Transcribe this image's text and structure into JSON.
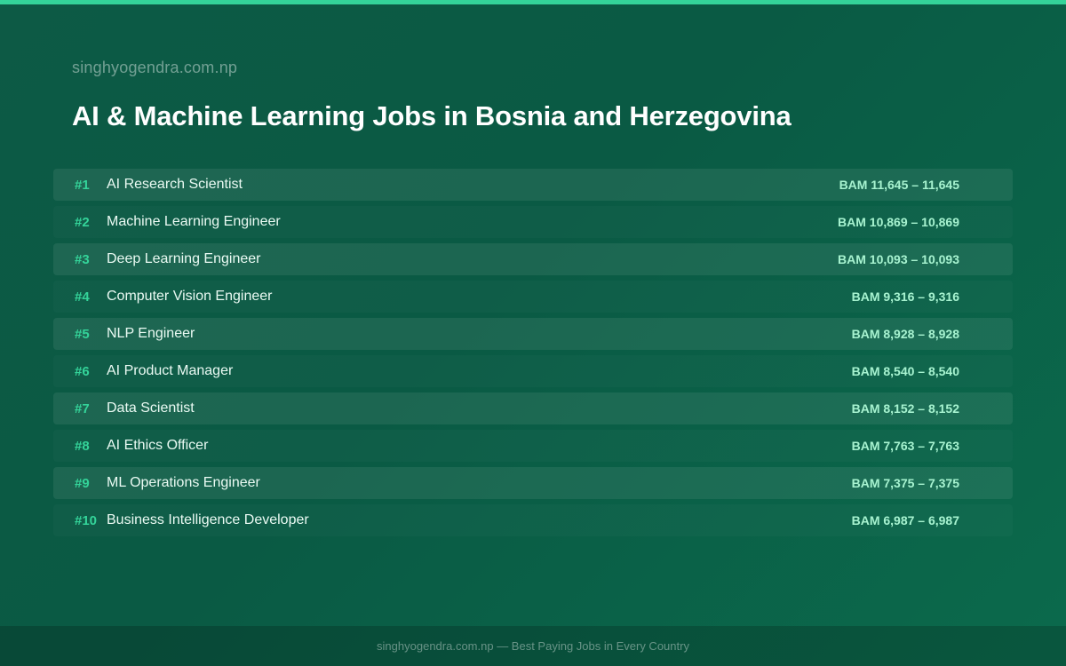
{
  "header": {
    "site": "singhyogendra.com.np",
    "title": "AI & Machine Learning Jobs in Bosnia and Herzegovina"
  },
  "jobs": [
    {
      "rank": "#1",
      "title": "AI Research Scientist",
      "salary": "BAM 11,645 – 11,645"
    },
    {
      "rank": "#2",
      "title": "Machine Learning Engineer",
      "salary": "BAM 10,869 – 10,869"
    },
    {
      "rank": "#3",
      "title": "Deep Learning Engineer",
      "salary": "BAM 10,093 – 10,093"
    },
    {
      "rank": "#4",
      "title": "Computer Vision Engineer",
      "salary": "BAM 9,316 – 9,316"
    },
    {
      "rank": "#5",
      "title": "NLP Engineer",
      "salary": "BAM 8,928 – 8,928"
    },
    {
      "rank": "#6",
      "title": "AI Product Manager",
      "salary": "BAM 8,540 – 8,540"
    },
    {
      "rank": "#7",
      "title": "Data Scientist",
      "salary": "BAM 8,152 – 8,152"
    },
    {
      "rank": "#8",
      "title": "AI Ethics Officer",
      "salary": "BAM 7,763 – 7,763"
    },
    {
      "rank": "#9",
      "title": "ML Operations Engineer",
      "salary": "BAM 7,375 – 7,375"
    },
    {
      "rank": "#10",
      "title": "Business Intelligence Developer",
      "salary": "BAM 6,987 – 6,987"
    }
  ],
  "footer": {
    "text": "singhyogendra.com.np — Best Paying Jobs in Every Country"
  },
  "colors": {
    "accent": "#34d399",
    "salary": "#a7f3d0",
    "background": "#0b5e47"
  }
}
